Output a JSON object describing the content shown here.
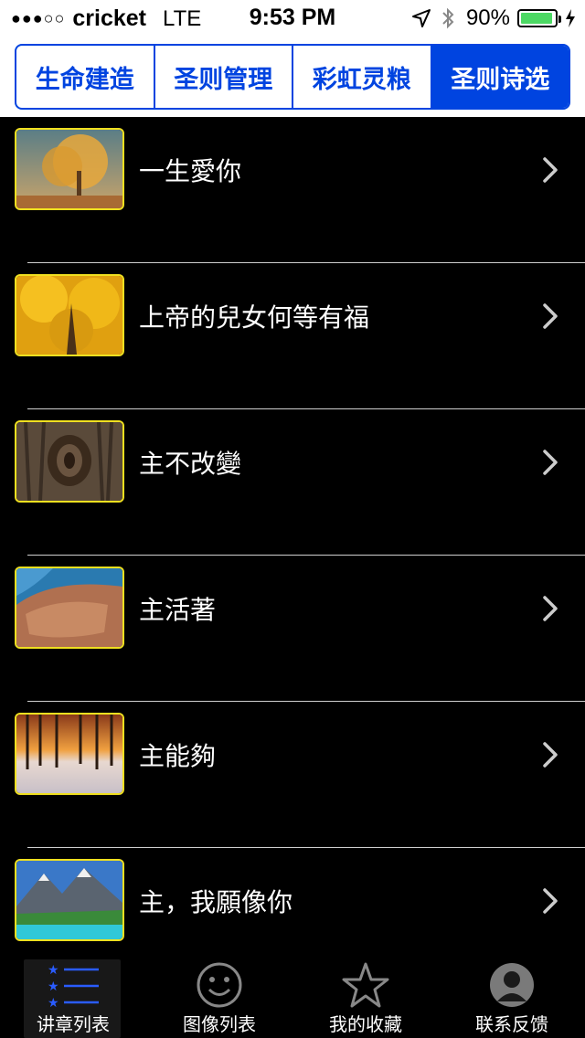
{
  "status": {
    "signal": "●●●○○",
    "carrier": "cricket",
    "network": "LTE",
    "time": "9:53 PM",
    "battery": "90%"
  },
  "segments": [
    {
      "label": "生命建造",
      "active": false
    },
    {
      "label": "圣则管理",
      "active": false
    },
    {
      "label": "彩虹灵粮",
      "active": false
    },
    {
      "label": "圣则诗选",
      "active": true
    }
  ],
  "items": [
    {
      "title": "一生愛你",
      "thumb": "autumn-tree"
    },
    {
      "title": "上帝的兒女何等有福",
      "thumb": "golden-tree"
    },
    {
      "title": "主不改變",
      "thumb": "tree-bark"
    },
    {
      "title": "主活著",
      "thumb": "coastal-city"
    },
    {
      "title": "主能夠",
      "thumb": "winter-sunset"
    },
    {
      "title": "主，我願像你",
      "thumb": "mountain-lake"
    }
  ],
  "tabs": [
    {
      "label": "讲章列表",
      "icon": "list-icon",
      "active": true
    },
    {
      "label": "图像列表",
      "icon": "smiley-icon",
      "active": false
    },
    {
      "label": "我的收藏",
      "icon": "star-icon",
      "active": false
    },
    {
      "label": "联系反馈",
      "icon": "person-icon",
      "active": false
    }
  ],
  "colors": {
    "accent": "#0044e0",
    "thumb_border": "#f0e020",
    "battery": "#4cd964"
  }
}
